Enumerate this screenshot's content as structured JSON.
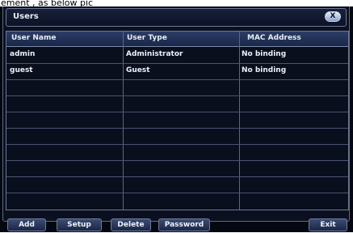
{
  "caption": "ement , as below pic",
  "window": {
    "title": "Users",
    "close_label": "X"
  },
  "table": {
    "columns": [
      "User Name",
      "User Type",
      "MAC Address"
    ],
    "rows": [
      [
        "admin",
        "Administrator",
        "No binding"
      ],
      [
        "guest",
        "Guest",
        "No binding"
      ]
    ]
  },
  "buttons": {
    "add": "Add",
    "setup": "Setup",
    "delete": "Delete",
    "password": "Password",
    "exit": "Exit"
  }
}
